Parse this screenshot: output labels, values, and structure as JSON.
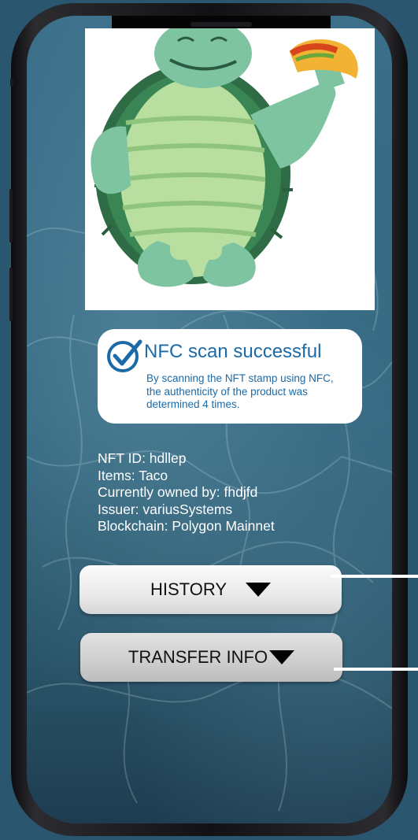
{
  "product": {
    "image_name": "turtle-holding-taco-illustration"
  },
  "nfc_status": {
    "icon": "check-circle-icon",
    "title": "NFC scan successful",
    "description": "By scanning the NFT stamp using NFC, the authenticity of the product was determined 4 times."
  },
  "nft_info": {
    "nft_id": "NFT ID: hdllep",
    "items": "Items: Taco",
    "owner": "Currently owned by: fhdjfd",
    "issuer": "Issuer: variusSystems",
    "blockchain": "Blockchain: Polygon Mainnet"
  },
  "buttons": {
    "history_label": "HISTORY",
    "transfer_label": "TRANSFER INFO"
  },
  "colors": {
    "accent": "#1b6aa8",
    "background": "#2b5670",
    "text_light": "#ffffff"
  }
}
